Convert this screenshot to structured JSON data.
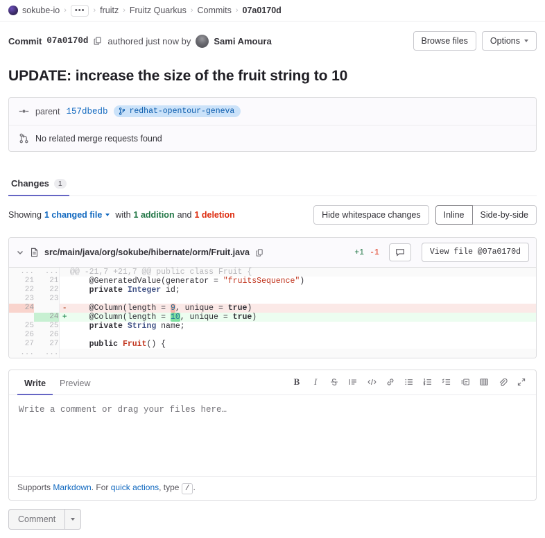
{
  "breadcrumb": {
    "group": "sokube-io",
    "ellipsis": "•••",
    "items": [
      "fruitz",
      "Fruitz Quarkus",
      "Commits"
    ],
    "current": "07a0170d",
    "separator": "›"
  },
  "commit_header": {
    "label": "Commit",
    "sha": "07a0170d",
    "copy_icon": "copy-icon",
    "authored_text": "authored just now by",
    "author": "Sami Amoura",
    "browse_files_label": "Browse files",
    "options_label": "Options"
  },
  "commit_message": "UPDATE: increase the size of the fruit string to 10",
  "parent_box": {
    "parent_label": "parent",
    "parent_sha": "157dbedb",
    "branch_name": "redhat-opentour-geneva",
    "merge_request_text": "No related merge requests found",
    "commit_icon": "commit-icon",
    "branch_icon": "branch-icon",
    "merge_icon": "merge-request-icon"
  },
  "tabs": [
    {
      "label": "Changes",
      "count": "1",
      "active": true
    }
  ],
  "showing": {
    "prefix": "Showing",
    "changed_file_link": "1 changed file",
    "with_text": "with",
    "additions": "1 addition",
    "and_text": "and",
    "deletions": "1 deletion",
    "whitespace_label": "Hide whitespace changes",
    "view_modes": [
      {
        "label": "Inline",
        "active": true
      },
      {
        "label": "Side-by-side",
        "active": false
      }
    ]
  },
  "diff_file": {
    "path": "src/main/java/org/sokube/hibernate/orm/Fruit.java",
    "file_icon": "file-icon",
    "collapse_icon": "chevron-down-icon",
    "copy_path_icon": "copy-icon",
    "additions": "+1",
    "deletions": "-1",
    "comment_icon": "comment-icon",
    "view_file_label": "View file @07a0170d",
    "hunk_header": "@@ -21,7 +21,7 @@ public class Fruit {",
    "lines": [
      {
        "type": "hunk",
        "old": "...",
        "new": "...",
        "sign": "",
        "text": "@@ -21,7 +21,7 @@ public class Fruit {"
      },
      {
        "type": "ctx",
        "old": "21",
        "new": "21",
        "sign": "",
        "text": "    @GeneratedValue(generator = \"fruitsSequence\")"
      },
      {
        "type": "ctx",
        "old": "22",
        "new": "22",
        "sign": "",
        "text": "    private Integer id;"
      },
      {
        "type": "ctx",
        "old": "23",
        "new": "23",
        "sign": "",
        "text": ""
      },
      {
        "type": "del",
        "old": "24",
        "new": "",
        "sign": "-",
        "text": "    @Column(length = 9, unique = true)"
      },
      {
        "type": "add",
        "old": "",
        "new": "24",
        "sign": "+",
        "text": "    @Column(length = 10, unique = true)"
      },
      {
        "type": "ctx",
        "old": "25",
        "new": "25",
        "sign": "",
        "text": "    private String name;"
      },
      {
        "type": "ctx",
        "old": "26",
        "new": "26",
        "sign": "",
        "text": ""
      },
      {
        "type": "ctx",
        "old": "27",
        "new": "27",
        "sign": "",
        "text": "    public Fruit() {"
      },
      {
        "type": "hunk",
        "old": "...",
        "new": "...",
        "sign": "",
        "text": ""
      }
    ],
    "word_diff": {
      "removed_value": "9",
      "added_value": "10"
    }
  },
  "editor": {
    "tabs": [
      {
        "label": "Write",
        "active": true
      },
      {
        "label": "Preview",
        "active": false
      }
    ],
    "toolbar": [
      {
        "name": "bold-icon",
        "glyph": "B"
      },
      {
        "name": "italic-icon",
        "glyph": "I"
      },
      {
        "name": "strikethrough-icon",
        "glyph": "S"
      },
      {
        "name": "quote-icon",
        "glyph": "quote"
      },
      {
        "name": "code-icon",
        "glyph": "</>"
      },
      {
        "name": "link-icon",
        "glyph": "link"
      },
      {
        "name": "bullet-list-icon",
        "glyph": "ul"
      },
      {
        "name": "numbered-list-icon",
        "glyph": "ol"
      },
      {
        "name": "task-list-icon",
        "glyph": "task"
      },
      {
        "name": "collapsible-section-icon",
        "glyph": "details"
      },
      {
        "name": "table-icon",
        "glyph": "table"
      },
      {
        "name": "attachment-icon",
        "glyph": "paperclip"
      },
      {
        "name": "fullscreen-icon",
        "glyph": "expand"
      }
    ],
    "comment_value": "",
    "comment_placeholder": "Write a comment or drag your files here…",
    "footer": {
      "supports": "Supports",
      "markdown_link": "Markdown",
      "for_text": ". For",
      "quick_actions_link": "quick actions",
      "type_text": ", type",
      "slash_key": "/",
      "period": "."
    },
    "comment_button_label": "Comment"
  },
  "colors": {
    "accent": "#6666c4",
    "link": "#1068bf",
    "addition": "#217645",
    "deletion": "#dd2b0e",
    "branch_badge_bg": "#cbe2f9",
    "branch_badge_fg": "#0b5cad"
  }
}
